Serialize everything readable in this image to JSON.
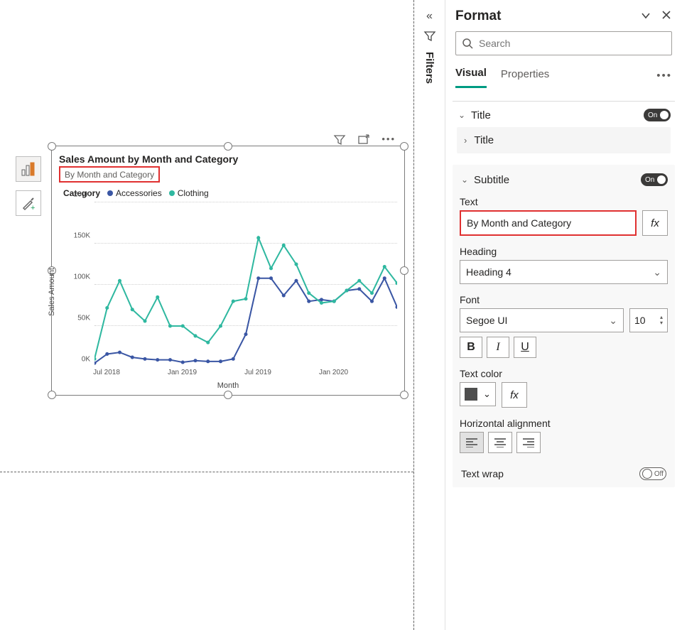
{
  "panel": {
    "title": "Format",
    "search_placeholder": "Search",
    "tabs": {
      "visual": "Visual",
      "properties": "Properties"
    }
  },
  "title_section": {
    "label": "Title",
    "toggle_label": "On",
    "subcard_label": "Title"
  },
  "subtitle_section": {
    "label": "Subtitle",
    "toggle_label": "On",
    "text_label": "Text",
    "text_value": "By Month and Category",
    "heading_label": "Heading",
    "heading_value": "Heading 4",
    "font_label": "Font",
    "font_value": "Segoe UI",
    "font_size": "10",
    "textcolor_label": "Text color",
    "text_color": "#4e4e4e",
    "halign_label": "Horizontal alignment",
    "textwrap_label": "Text wrap",
    "textwrap_toggle_label": "Off"
  },
  "filters_label": "Filters",
  "chart": {
    "title": "Sales Amount by Month and Category",
    "subtitle": "By Month and Category",
    "legend_label": "Category",
    "legend_items": [
      {
        "name": "Accessories",
        "color": "#3a56a4"
      },
      {
        "name": "Clothing",
        "color": "#2fb8a0"
      }
    ],
    "xlabel": "Month",
    "ylabel": "Sales Amount",
    "yticks": [
      "0K",
      "50K",
      "100K",
      "150K",
      "200K"
    ],
    "xticks": [
      "Jul 2018",
      "Jan 2019",
      "Jul 2019",
      "Jan 2020"
    ]
  },
  "chart_data": {
    "type": "line",
    "title": "Sales Amount by Month and Category",
    "xlabel": "Month",
    "ylabel": "Sales Amount",
    "ylim": [
      0,
      200000
    ],
    "x": [
      "2018-06",
      "2018-07",
      "2018-08",
      "2018-09",
      "2018-10",
      "2018-11",
      "2018-12",
      "2019-01",
      "2019-02",
      "2019-03",
      "2019-04",
      "2019-05",
      "2019-06",
      "2019-07",
      "2019-08",
      "2019-09",
      "2019-10",
      "2019-11",
      "2019-12",
      "2020-01",
      "2020-02",
      "2020-03",
      "2020-04",
      "2020-05",
      "2020-06"
    ],
    "series": [
      {
        "name": "Accessories",
        "color": "#3a56a4",
        "values": [
          5000,
          16000,
          18000,
          12000,
          10000,
          9000,
          9000,
          6000,
          8000,
          7000,
          7000,
          10000,
          40000,
          108000,
          108000,
          87000,
          105000,
          80000,
          82000,
          80000,
          93000,
          95000,
          80000,
          108000,
          73000
        ]
      },
      {
        "name": "Clothing",
        "color": "#2fb8a0",
        "values": [
          10000,
          72000,
          105000,
          70000,
          56000,
          85000,
          50000,
          50000,
          38000,
          30000,
          50000,
          80000,
          83000,
          157000,
          120000,
          148000,
          125000,
          90000,
          78000,
          80000,
          93000,
          105000,
          90000,
          122000,
          102000
        ]
      }
    ]
  }
}
